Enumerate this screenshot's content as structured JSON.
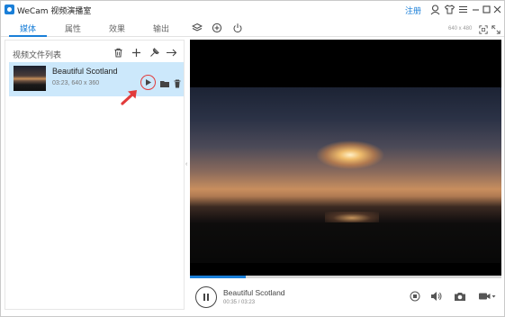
{
  "app": {
    "title": "WeCam 视频演播室",
    "register_link": "注册"
  },
  "tabs": [
    {
      "label": "媒体",
      "active": true
    },
    {
      "label": "属性",
      "active": false
    },
    {
      "label": "效果",
      "active": false
    },
    {
      "label": "输出",
      "active": false
    }
  ],
  "preview": {
    "resolution_label": "640 x 480"
  },
  "left_panel": {
    "title": "视频文件列表"
  },
  "file_list": [
    {
      "name": "Beautiful Scotland",
      "meta": "03:23, 640 x 360"
    }
  ],
  "player": {
    "title": "Beautiful Scotland",
    "time": "00:35 / 03:23",
    "progress": 0.18
  },
  "colors": {
    "accent": "#1a7fd8",
    "highlight": "#e23b3b",
    "selected_row": "#cce8fb"
  }
}
